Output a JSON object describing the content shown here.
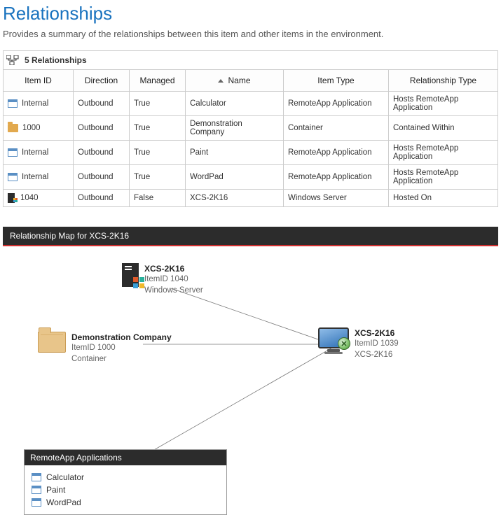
{
  "title": "Relationships",
  "subtitle": "Provides a summary of the relationships between this item and other items in the environment.",
  "count_label": "5 Relationships",
  "columns": [
    "Item ID",
    "Direction",
    "Managed",
    "Name",
    "Item Type",
    "Relationship Type"
  ],
  "sort_column": "Name",
  "rows": [
    {
      "icon": "app",
      "id": "Internal",
      "dir": "Outbound",
      "managed": "True",
      "name": "Calculator",
      "type": "RemoteApp Application",
      "rel": "Hosts RemoteApp Application"
    },
    {
      "icon": "folder",
      "id": "1000",
      "dir": "Outbound",
      "managed": "True",
      "name": "Demonstration Company",
      "type": "Container",
      "rel": "Contained Within"
    },
    {
      "icon": "app",
      "id": "Internal",
      "dir": "Outbound",
      "managed": "True",
      "name": "Paint",
      "type": "RemoteApp Application",
      "rel": "Hosts RemoteApp Application"
    },
    {
      "icon": "app",
      "id": "Internal",
      "dir": "Outbound",
      "managed": "True",
      "name": "WordPad",
      "type": "RemoteApp Application",
      "rel": "Hosts RemoteApp Application"
    },
    {
      "icon": "server",
      "id": "1040",
      "dir": "Outbound",
      "managed": "False",
      "name": "XCS-2K16",
      "type": "Windows Server",
      "rel": "Hosted On"
    }
  ],
  "map": {
    "header": "Relationship Map for XCS-2K16",
    "nodes": {
      "server": {
        "name": "XCS-2K16",
        "line1": "ItemID 1040",
        "line2": "Windows Server"
      },
      "folder": {
        "name": "Demonstration Company",
        "line1": "ItemID 1000",
        "line2": "Container"
      },
      "center": {
        "name": "XCS-2K16",
        "line1": "ItemID 1039",
        "line2": "XCS-2K16"
      }
    },
    "apps": {
      "header": "RemoteApp Applications",
      "items": [
        "Calculator",
        "Paint",
        "WordPad"
      ]
    }
  }
}
